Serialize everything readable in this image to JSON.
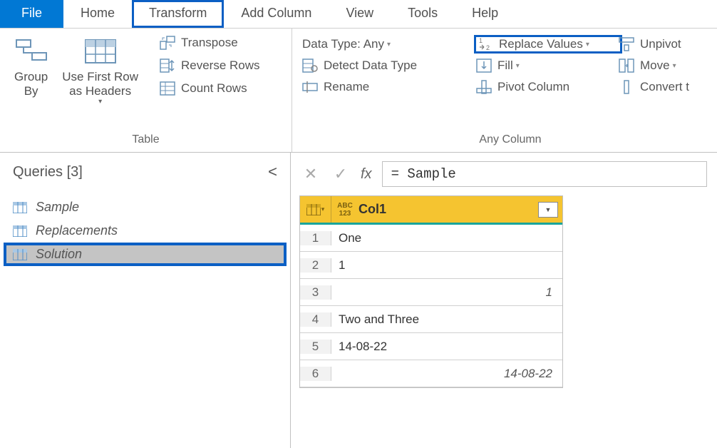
{
  "tabs": {
    "file": "File",
    "home": "Home",
    "transform": "Transform",
    "add_column": "Add Column",
    "view": "View",
    "tools": "Tools",
    "help": "Help"
  },
  "ribbon": {
    "table": {
      "group_by": "Group\nBy",
      "use_first": "Use First Row\nas Headers",
      "transpose": "Transpose",
      "reverse": "Reverse Rows",
      "count": "Count Rows",
      "label": "Table"
    },
    "anycol": {
      "datatype": "Data Type: Any",
      "detect": "Detect Data Type",
      "rename": "Rename",
      "replace": "Replace Values",
      "fill": "Fill",
      "pivot": "Pivot Column",
      "unpivot": "Unpivot ",
      "move": "Move",
      "convert": "Convert t",
      "label": "Any Column"
    }
  },
  "queries": {
    "title": "Queries [3]",
    "items": [
      "Sample",
      "Replacements",
      "Solution"
    ],
    "selected": 2
  },
  "formula": "= Sample",
  "grid": {
    "column": "Col1",
    "rows": [
      {
        "i": 1,
        "v": "One",
        "align": "left"
      },
      {
        "i": 2,
        "v": "1",
        "align": "left"
      },
      {
        "i": 3,
        "v": "1",
        "align": "right"
      },
      {
        "i": 4,
        "v": "Two and Three",
        "align": "left"
      },
      {
        "i": 5,
        "v": "14-08-22",
        "align": "left"
      },
      {
        "i": 6,
        "v": "14-08-22",
        "align": "right"
      }
    ]
  }
}
